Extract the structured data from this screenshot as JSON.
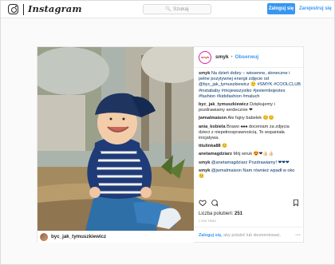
{
  "header": {
    "logo_text": "Instagram",
    "search_placeholder": "Szukaj",
    "login_label": "Zaloguj się",
    "signup_label": "Zarejestruj się"
  },
  "post": {
    "username": "smyk",
    "follow_label": "Obserwuj",
    "avatar_text": "smyk",
    "photo_credit_user": "byc_jak_tymuszkiewicz",
    "caption_user": "smyk",
    "caption_text": "Na dzień dobry – wiosenne, słoneczne i pełne pozytywnej energii zdjęcie od @byc_jak_tymuszkiewicz 🙂 #SMYK #COOLCLUB #instababy #mojewszystko #jestembojestes #fashion #kidsfashion #maluch",
    "comments": [
      {
        "user": "byc_jak_tymuszkiewicz",
        "text": "Dziękujemy i pozdrawiamy serdecznie ❤"
      },
      {
        "user": "jwmalmaison",
        "text": "Ale fajny babelek 😊😊"
      },
      {
        "user": "ania_kobiela",
        "text": "Brawo ♠♠♠ doceniam za zdjęcia dzieci z niepełnosprawnością. To wspaniała inicjatywa."
      },
      {
        "user": "titulinka88",
        "text": "😊"
      },
      {
        "user": "anetamagdziarz",
        "text": "Mój wnuk 😍❤👍🏻👍🏻"
      },
      {
        "user": "smyk",
        "text": "@anetamagdziarz Pozdrawiamy! ❤❤❤"
      },
      {
        "user": "smyk",
        "text": "@jwmalmaison Nam również wpadł w oko 😊"
      }
    ],
    "likes_label": "Liczba polubień:",
    "likes_count": "251",
    "date": "1 DNI TEMU",
    "footer_login": "Zaloguj się,",
    "footer_text": " aby polubić lub skomentować.",
    "more_label": "···"
  },
  "icons": {
    "logo": "instagram-camera-icon",
    "search": "magnifier-icon",
    "like": "heart-icon",
    "comment": "speech-bubble-icon",
    "save": "bookmark-icon",
    "more": "ellipsis-icon"
  },
  "colors": {
    "accent": "#3897f0",
    "text": "#262626",
    "muted": "#999999"
  }
}
